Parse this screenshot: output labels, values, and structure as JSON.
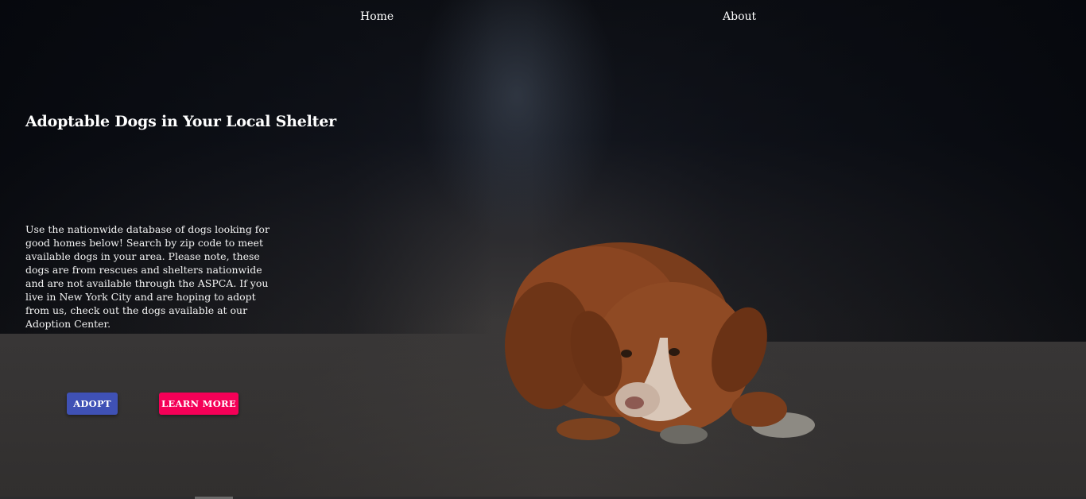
{
  "nav": {
    "home_label": "Home",
    "about_label": "About"
  },
  "hero": {
    "title": "Adoptable Dogs in Your Local Shelter",
    "description": "Use the nationwide database of dogs looking for good homes below! Search by zip code to meet available dogs in your area. Please note, these dogs are from rescues and shelters nationwide and are not available through the ASPCA. If you live in New York City and are hoping to adopt from us, check out the dogs available at our Adoption Center.",
    "adopt_label": "ADOPT",
    "learn_more_label": "LEARN MORE"
  },
  "colors": {
    "adopt_button": "#3f51b5",
    "learn_more_button": "#f50057",
    "background": "#1a1c22"
  }
}
